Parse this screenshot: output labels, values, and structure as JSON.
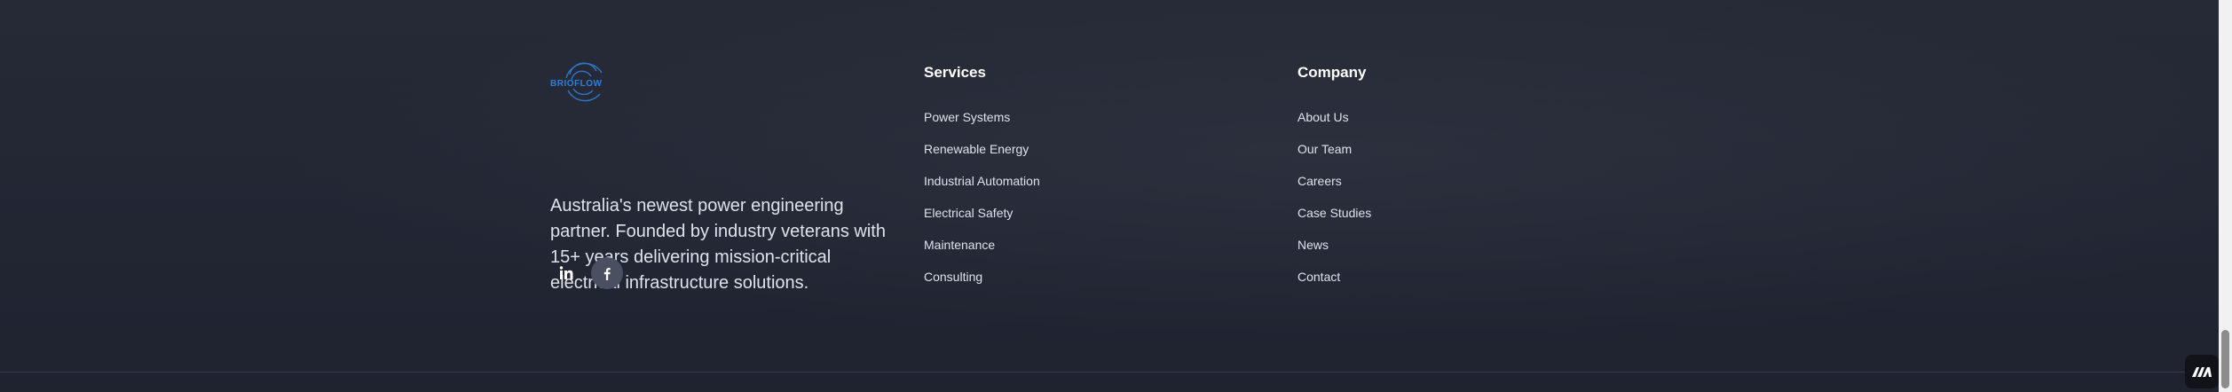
{
  "brand": {
    "logo_text": "BRIOFLOW",
    "tagline": "Australia's newest power engineering partner. Founded by industry veterans with 15+ years delivering mission-critical electrical infrastructure solutions.",
    "socials": [
      {
        "name": "linkedin",
        "icon": "linkedin-icon"
      },
      {
        "name": "facebook",
        "icon": "facebook-icon"
      }
    ]
  },
  "services": {
    "heading": "Services",
    "links": [
      "Power Systems",
      "Renewable Energy",
      "Industrial Automation",
      "Electrical Safety",
      "Maintenance",
      "Consulting"
    ]
  },
  "company": {
    "heading": "Company",
    "links": [
      "About Us",
      "Our Team",
      "Careers",
      "Case Studies",
      "News",
      "Contact"
    ]
  },
  "colors": {
    "background": "#232734",
    "text": "#dfe2ea",
    "heading": "#ffffff",
    "logo_accent": "#2f7ed8",
    "social_bg": "#4a5062"
  },
  "badge_icon": "made-with-icon"
}
